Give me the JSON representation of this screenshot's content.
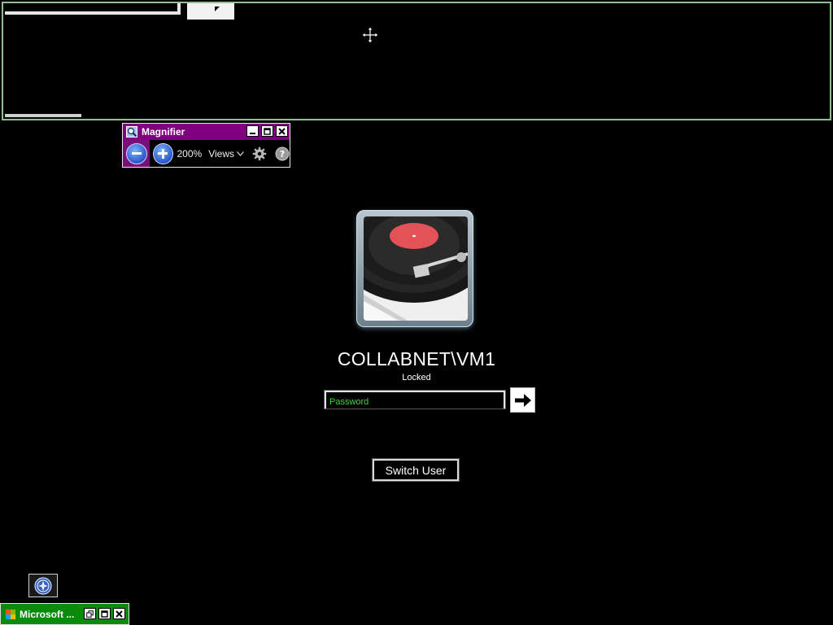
{
  "magnifier": {
    "title": "Magnifier",
    "zoom_level": "200%",
    "views_label": "Views",
    "icons": {
      "app": "magnifier-app-icon",
      "zoom_out": "minus-icon",
      "zoom_in": "plus-icon",
      "views": "chevron-down-icon",
      "options": "gear-icon",
      "help": "question-icon",
      "minimize": "minimize-icon",
      "maximize": "maximize-icon",
      "close": "close-icon"
    }
  },
  "lock_screen": {
    "user_name": "COLLABNET\\VM1",
    "status": "Locked",
    "password_placeholder": "Password",
    "password_value": "",
    "switch_user_label": "Switch User",
    "submit_icon": "arrow-right-icon",
    "avatar_icon": "turntable-avatar"
  },
  "taskbar": {
    "task_label": "Microsoft ...",
    "ease_of_access_icon": "ease-of-access-icon"
  },
  "colors": {
    "background": "#000000",
    "magnifier_accent": "#800080",
    "task_accent": "#0b8a0b",
    "password_placeholder": "#3fd83f",
    "docked_view_border": "#8fbf8f"
  }
}
